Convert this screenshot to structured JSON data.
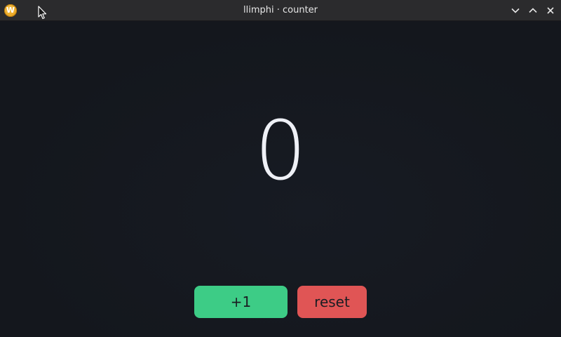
{
  "window": {
    "title": "llimphi · counter",
    "app_icon_letter": "W"
  },
  "counter": {
    "value": "0"
  },
  "buttons": {
    "increment_label": "+1",
    "reset_label": "reset"
  },
  "colors": {
    "increment": "#3dcc86",
    "reset": "#e05555",
    "background": "#15181f",
    "titlebar": "#2b2b2d"
  },
  "icons": {
    "minimize": "chevron-down-icon",
    "maximize": "chevron-up-icon",
    "close": "close-icon"
  }
}
